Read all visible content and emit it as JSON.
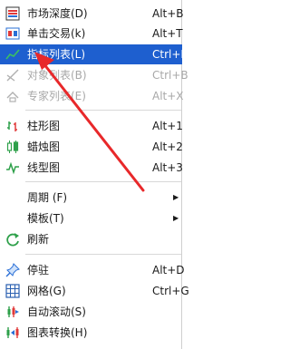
{
  "menu": {
    "items": [
      {
        "label": "市场深度(D)",
        "shortcut": "Alt+B",
        "icon": "market-depth-icon"
      },
      {
        "label": "单击交易(k)",
        "shortcut": "Alt+T",
        "icon": "one-click-trading-icon"
      },
      {
        "label": "指标列表(L)",
        "shortcut": "Ctrl+I",
        "icon": "indicators-list-icon"
      },
      {
        "label": "对象列表(B)",
        "shortcut": "Ctrl+B",
        "icon": "objects-list-icon"
      },
      {
        "label": "专家列表(E)",
        "shortcut": "Alt+X",
        "icon": "experts-list-icon"
      },
      {
        "label": "柱形图",
        "shortcut": "Alt+1",
        "icon": "bar-chart-icon"
      },
      {
        "label": "蜡烛图",
        "shortcut": "Alt+2",
        "icon": "candlestick-icon"
      },
      {
        "label": "线型图",
        "shortcut": "Alt+3",
        "icon": "line-chart-icon"
      },
      {
        "label": "周期 (F)",
        "submenu_arrow": "▶"
      },
      {
        "label": "模板(T)",
        "submenu_arrow": "▶"
      },
      {
        "label": "刷新",
        "icon": "refresh-icon"
      },
      {
        "label": "停驻",
        "shortcut": "Alt+D",
        "icon": "pin-icon"
      },
      {
        "label": "网格(G)",
        "shortcut": "Ctrl+G",
        "icon": "grid-icon"
      },
      {
        "label": "自动滚动(S)",
        "icon": "auto-scroll-icon"
      },
      {
        "label": "图表转换(H)",
        "icon": "chart-shift-icon"
      }
    ]
  },
  "colors": {
    "highlight": "#1e5fcf",
    "annotation_arrow": "#e8282a",
    "disabled_text": "#a8a8a8"
  }
}
